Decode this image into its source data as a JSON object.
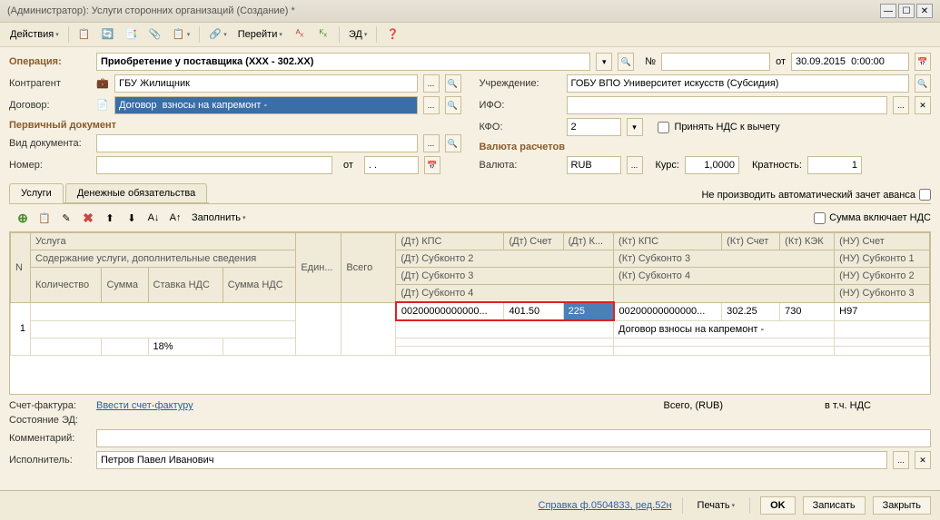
{
  "window": {
    "title": "(Администратор): Услуги сторонних организаций (Создание) *"
  },
  "toolbar": {
    "actions": "Действия",
    "navigate": "Перейти",
    "ed": "ЭД"
  },
  "form": {
    "operation_label": "Операция:",
    "operation_value": "Приобретение у поставщика (XXX - 302.XX)",
    "num_label": "№",
    "from_label": "от",
    "date_value": "30.09.2015  0:00:00",
    "contractor_label": "Контрагент",
    "contractor_value": "ГБУ Жилищник",
    "institution_label": "Учреждение:",
    "institution_value": "ГОБУ ВПО Университет искусств (Субсидия)",
    "contract_label": "Договор:",
    "contract_value": "Договор  взносы на капремонт -",
    "ifo_label": "ИФО:",
    "kfo_label": "КФО:",
    "kfo_value": "2",
    "accept_vat": "Принять НДС к вычету",
    "primary_doc_header": "Первичный документ",
    "doc_type_label": "Вид документа:",
    "number_label": "Номер:",
    "number_from": "от",
    "date_placeholder": ". .",
    "currency_header": "Валюта расчетов",
    "currency_label": "Валюта:",
    "currency_value": "RUB",
    "rate_label": "Курс:",
    "rate_value": "1,0000",
    "multiplicity_label": "Кратность:",
    "multiplicity_value": "1"
  },
  "tabs": {
    "services": "Услуги",
    "obligations": "Денежные обязательства",
    "no_auto_offset": "Не производить автоматический зачет аванса",
    "sum_includes_vat": "Сумма включает НДС",
    "fill": "Заполнить"
  },
  "table": {
    "headers": {
      "n": "N",
      "service": "Услуга",
      "unit": "Един...",
      "total": "Всего",
      "dt_kps": "(Дт) КПС",
      "dt_account": "(Дт) Счет",
      "dt_k": "(Дт) К...",
      "kt_kps": "(Кт) КПС",
      "kt_account": "(Кт) Счет",
      "kt_kek": "(Кт) КЭК",
      "nu_account": "(НУ) Счет",
      "service_desc": "Содержание услуги, дополнительные сведения",
      "dt_sub2": "(Дт) Субконто 2",
      "kt_sub3": "(Кт) Субконто 3",
      "nu_sub1": "(НУ) Субконто 1",
      "qty": "Количество",
      "sum": "Сумма",
      "vat_rate": "Ставка НДС",
      "vat_sum": "Сумма НДС",
      "dt_sub3": "(Дт) Субконто 3",
      "kt_sub4": "(Кт) Субконто 4",
      "nu_sub2": "(НУ) Субконто 2",
      "dt_sub4": "(Дт) Субконто 4",
      "nu_sub3": "(НУ) Субконто 3"
    },
    "row": {
      "n": "1",
      "dt_kps": "00200000000000...",
      "dt_account": "401.50",
      "dt_k": "225",
      "kt_kps": "00200000000000...",
      "kt_account": "302.25",
      "kt_kek": "730",
      "nu_account": "Н97",
      "kt_sub3_val": "Договор  взносы на капремонт -",
      "vat_rate": "18%"
    }
  },
  "bottom": {
    "invoice_label": "Счет-фактура:",
    "invoice_link": "Ввести счет-фактуру",
    "total_label": "Всего, (RUB)",
    "vat_total_label": "в т.ч. НДС",
    "ed_state_label": "Состояние ЭД:",
    "comment_label": "Комментарий:",
    "executor_label": "Исполнитель:",
    "executor_value": "Петров Павел Иванович"
  },
  "footer": {
    "ref": "Справка ф.0504833, ред.52н",
    "print": "Печать",
    "ok": "OK",
    "save": "Записать",
    "close": "Закрыть"
  }
}
